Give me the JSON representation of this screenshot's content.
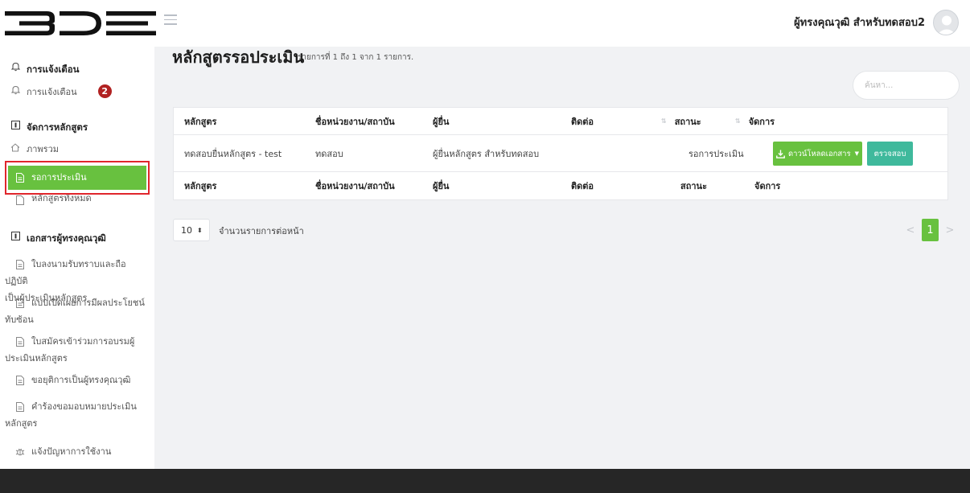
{
  "header": {
    "user_name": "ผู้ทรงคุณวุฒิ สำหรับทดสอบ2"
  },
  "sidebar": {
    "notification_heading": "การแจ้งเตือน",
    "notification_link": "การแจ้งเตือน",
    "notification_count": "2",
    "course_heading": "จัดการหลักสูตร",
    "overview": "ภาพรวม",
    "pending": "รอการประเมิน",
    "all_courses": "หลักสูตรทั้งหมด",
    "docs_heading": "เอกสารผู้ทรงคุณวุฒิ",
    "docs": [
      [
        "ใบลงนามรับทราบและถือปฏิบัติ",
        "เป็นผู้ประเมินหลักสูตร"
      ],
      [
        "แบบเปิดเผยการมีผลประโยชน์",
        "ทับซ้อน"
      ],
      [
        "ใบสมัครเข้าร่วมการอบรมผู้",
        "ประเมินหลักสูตร"
      ],
      [
        "ขอยุติการเป็นผู้ทรงคุณวุฒิ"
      ],
      [
        "คำร้องขอมอบหมายประเมิน",
        "หลักสูตร"
      ]
    ],
    "report_issue": "แจ้งปัญหาการใช้งาน"
  },
  "main": {
    "title": "หลักสูตรรอประเมิน",
    "subtitle": "รายการที่ 1 ถึง 1 จาก 1 รายการ.",
    "search_placeholder": "ค้นหา...",
    "columns": [
      "หลักสูตร",
      "ชื่อหน่วยงาน/สถาบัน",
      "ผู้ยื่น",
      "ติดต่อ",
      "สถานะ",
      "จัดการ"
    ],
    "rows": [
      {
        "course": "ทดสอบยื่นหลักสูตร - test",
        "org": "ทดสอบ",
        "submitter": "ผู้ยื่นหลักสูตร สำหรับทดสอบ",
        "contact": "",
        "status": "รอการประเมิน",
        "download_label": "ดาวน์โหลดเอกสาร",
        "check_label": "ตรวจสอบ"
      }
    ],
    "page_size": "10",
    "page_size_label": "จำนวนรายการต่อหน้า",
    "pagination": {
      "prev": "<",
      "current": "1",
      "next": ">"
    }
  },
  "colors": {
    "accent_green": "#68c13f",
    "teal": "#3fb99c",
    "badge_red": "#b12121",
    "highlight_red": "#e0262c"
  }
}
